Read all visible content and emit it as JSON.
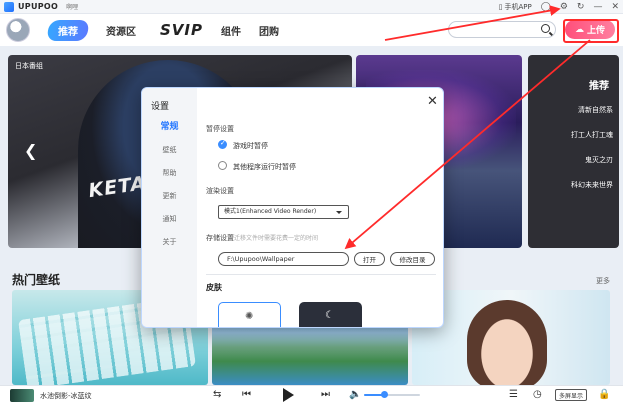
{
  "titlebar": {
    "brand": "UPUPOO",
    "subtitle": "啊哩",
    "phone_app": "手机APP"
  },
  "nav": {
    "items": [
      "推荐",
      "资源区",
      "SVIP",
      "组件",
      "团购"
    ],
    "search_placeholder": "",
    "upload_label": "上传"
  },
  "banner": {
    "tag": "日本番组",
    "overlay_text": "KETA HYUGA",
    "right_title": "推荐",
    "right_items": [
      "清新自然系",
      "打工人打工魂",
      "鬼灭之刃",
      "科幻未来世界"
    ]
  },
  "hot": {
    "title": "热门壁纸",
    "more": "更多"
  },
  "player": {
    "now_playing": "水池倒影-冰蓝纹",
    "multi_display": "多屏显示"
  },
  "settings": {
    "title": "设置",
    "nav": [
      "常规",
      "壁纸",
      "帮助",
      "更新",
      "通知",
      "关于"
    ],
    "pause_group": "暂停设置",
    "pause_options": [
      {
        "label": "游戏时暂停",
        "checked": true
      },
      {
        "label": "其他程序运行时暂停",
        "checked": false
      }
    ],
    "render_group": "渲染设置",
    "render_value": "模式1(Enhanced Video Render)",
    "storage_group": "存储设置",
    "storage_hint": "*迁移文件时需要花费一定的时间",
    "storage_path": "F:\\Upupoo\\Wallpaper",
    "open_label": "打开",
    "change_dir_label": "修改目录",
    "skin_title": "皮肤"
  },
  "colors": {
    "accent": "#3a8dff",
    "annotation": "#ff2b2b",
    "upload": "#ff4f7a"
  }
}
